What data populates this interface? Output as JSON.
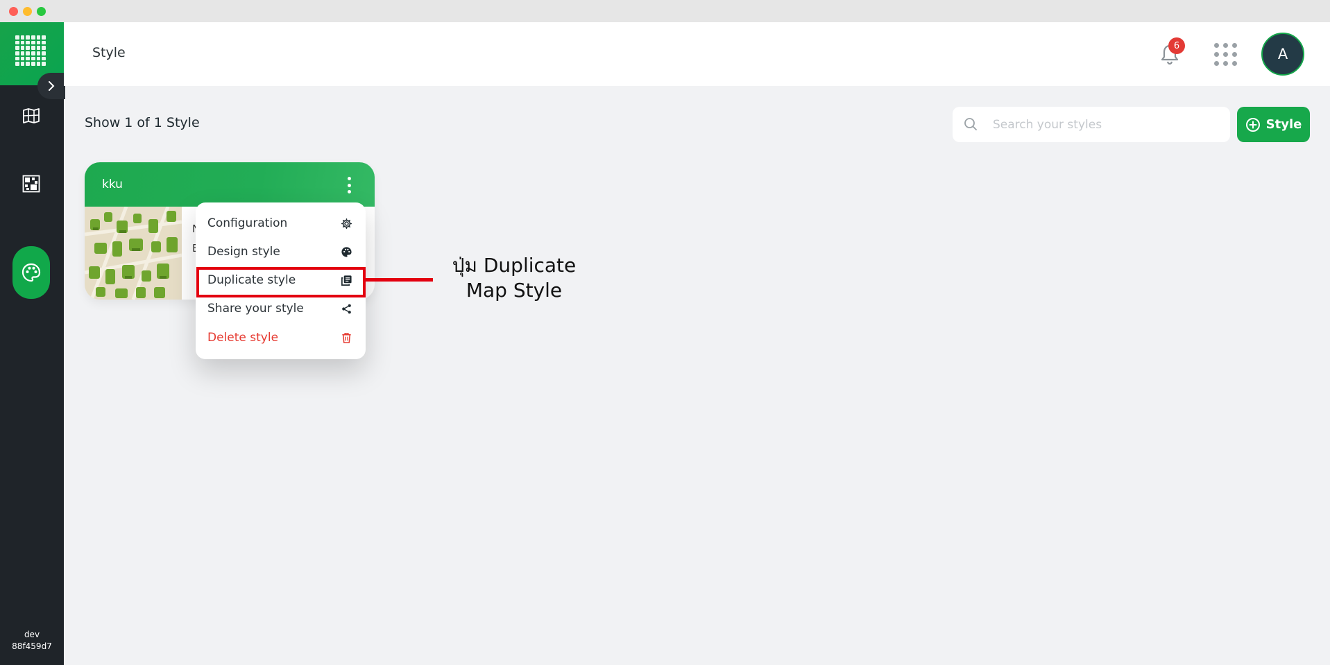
{
  "header": {
    "title": "Style",
    "notification_count": "6",
    "avatar_initial": "A"
  },
  "sidebar": {
    "build_env": "dev",
    "build_hash": "88f459d7"
  },
  "toolbar": {
    "count_text": "Show 1 of 1 Style",
    "search_placeholder": "Search your styles",
    "add_button_label": "Style"
  },
  "card": {
    "name": "kku",
    "meta_line1": "N",
    "meta_line2": "E"
  },
  "menu": {
    "items": [
      {
        "label": "Configuration",
        "icon": "gear-icon"
      },
      {
        "label": "Design style",
        "icon": "palette-icon"
      },
      {
        "label": "Duplicate style",
        "icon": "copy-icon"
      },
      {
        "label": "Share your style",
        "icon": "share-icon"
      },
      {
        "label": "Delete style",
        "icon": "trash-icon"
      }
    ]
  },
  "annotation": {
    "line1": "ปุ่ม Duplicate",
    "line2": "Map Style"
  },
  "colors": {
    "brand": "#17a84b",
    "danger": "#e63b32",
    "sidebar": "#1f2429",
    "highlight": "#e3000f"
  }
}
